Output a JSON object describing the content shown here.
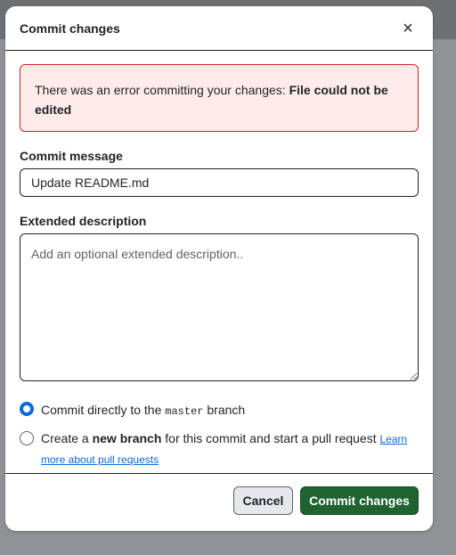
{
  "dialog": {
    "title": "Commit changes",
    "close_icon": "×"
  },
  "error": {
    "prefix": "There was an error committing your changes: ",
    "detail": "File could not be edited"
  },
  "commit_message": {
    "label": "Commit message",
    "value": "Update README.md"
  },
  "extended_description": {
    "label": "Extended description",
    "placeholder": "Add an optional extended description.."
  },
  "options": {
    "direct": {
      "text_before": "Commit directly to the ",
      "branch": "master",
      "text_after": " branch",
      "checked": true
    },
    "new_branch": {
      "text_before": "Create a ",
      "bold": "new branch",
      "text_after": " for this commit and start a pull request ",
      "link": "Learn more about pull requests",
      "checked": false
    }
  },
  "footer": {
    "cancel_label": "Cancel",
    "commit_label": "Commit changes"
  },
  "colors": {
    "primary_button": "#1f6331",
    "error_border": "#d1242f",
    "error_bg": "#ffebe9",
    "radio_accent": "#0969da"
  }
}
